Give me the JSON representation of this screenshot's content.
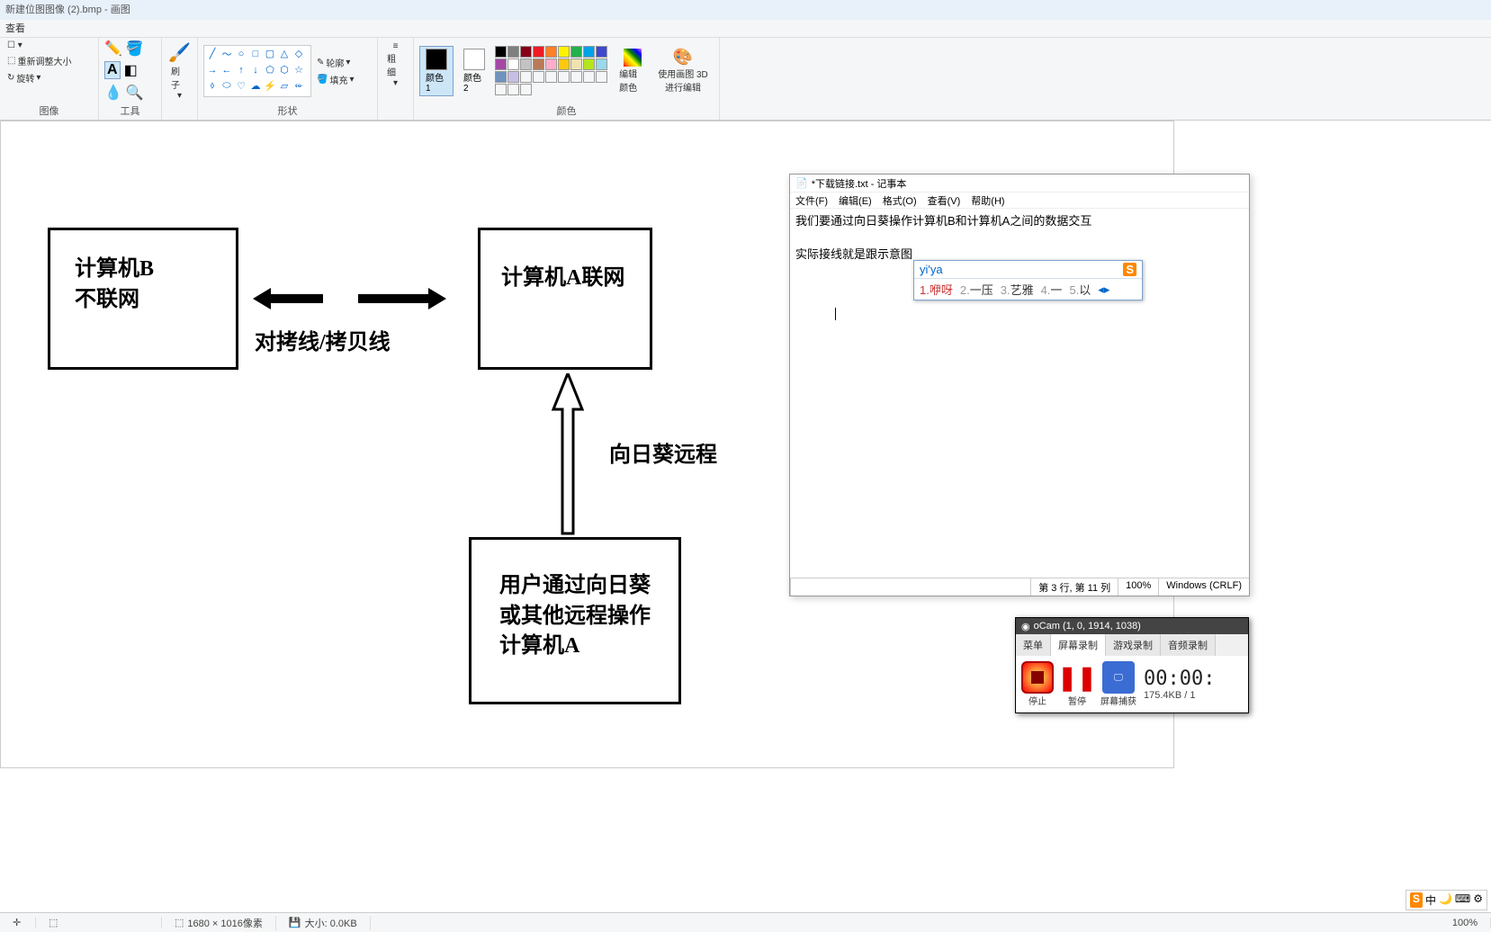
{
  "paint": {
    "title": "新建位图图像 (2).bmp - 画图",
    "view_tab": "查看",
    "groups": {
      "image": {
        "label": "图像",
        "resize": "重新调整大小",
        "rotate": "旋转"
      },
      "tools": {
        "label": "工具"
      },
      "shapes": {
        "label": "形状",
        "outline": "轮廓",
        "fill": "填充"
      },
      "stroke": {
        "label": "粗细"
      },
      "colors": {
        "label": "颜色",
        "color1": "颜色 1",
        "color2": "颜色 2",
        "edit": "编辑颜色",
        "paint3d": "使用画图 3D 进行编辑"
      },
      "brush": "刷子"
    },
    "canvas": {
      "boxB": "计算机B\n不联网",
      "boxA": "计算机A联网",
      "cable": "对拷线/拷贝线",
      "remote": "向日葵远程",
      "boxUser": "用户通过向日葵\n或其他远程操作\n计算机A"
    },
    "status": {
      "dims": "1680 × 1016像素",
      "size": "大小: 0.0KB",
      "zoom": "100%"
    }
  },
  "notepad": {
    "title": "*下载链接.txt - 记事本",
    "menu": {
      "file": "文件(F)",
      "edit": "编辑(E)",
      "format": "格式(O)",
      "view": "查看(V)",
      "help": "帮助(H)"
    },
    "line1": "我们要通过向日葵操作计算机B和计算机A之间的数据交互",
    "line2": "实际接线就是跟示意图",
    "status": {
      "pos": "第 3 行, 第 11 列",
      "zoom": "100%",
      "enc": "Windows (CRLF)"
    }
  },
  "ime": {
    "pinyin": "yi'ya",
    "cands": [
      {
        "n": "1.",
        "t": "咿呀"
      },
      {
        "n": "2.",
        "t": "一压"
      },
      {
        "n": "3.",
        "t": "艺雅"
      },
      {
        "n": "4.",
        "t": "一"
      },
      {
        "n": "5.",
        "t": "以"
      }
    ]
  },
  "ocam": {
    "title": "oCam (1, 0, 1914, 1038)",
    "tabs": {
      "menu": "菜单",
      "screen": "屏幕录制",
      "game": "游戏录制",
      "audio": "音频录制"
    },
    "btns": {
      "stop": "停止",
      "pause": "暂停",
      "capture": "屏幕捕获"
    },
    "timer": "00:00:",
    "rate": "175.4KB / 1"
  },
  "tray": "中"
}
